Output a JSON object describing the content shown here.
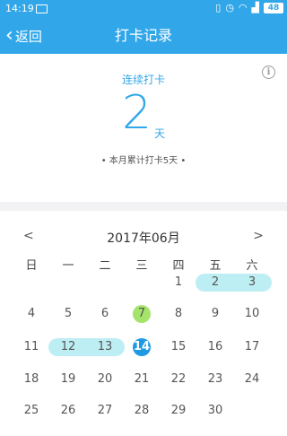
{
  "status_bar": {
    "time": "14:19",
    "battery": "48"
  },
  "header": {
    "back_label": "返回",
    "title": "打卡记录"
  },
  "summary": {
    "streak_label": "连续打卡",
    "streak_value": "2",
    "streak_unit": "天",
    "month_total": "• 本月累计打卡5天 •"
  },
  "calendar": {
    "prev": "<",
    "next": ">",
    "month_title": "2017年06月",
    "weekdays": [
      "日",
      "一",
      "二",
      "三",
      "四",
      "五",
      "六"
    ],
    "weeks": [
      [
        "",
        "",
        "",
        "",
        "1",
        "2",
        "3"
      ],
      [
        "4",
        "5",
        "6",
        "7",
        "8",
        "9",
        "10"
      ],
      [
        "11",
        "12",
        "13",
        "14",
        "15",
        "16",
        "17"
      ],
      [
        "18",
        "19",
        "20",
        "21",
        "22",
        "23",
        "24"
      ],
      [
        "25",
        "26",
        "27",
        "28",
        "29",
        "30",
        ""
      ]
    ],
    "checked_ranges": [
      [
        "2",
        "3"
      ],
      [
        "12",
        "13"
      ]
    ],
    "highlight_day": "7",
    "today": "14",
    "colors": {
      "range": "#bdeef3",
      "highlight": "#a4e46b",
      "today": "#1e9ae3",
      "accent": "#31a7e9"
    }
  }
}
